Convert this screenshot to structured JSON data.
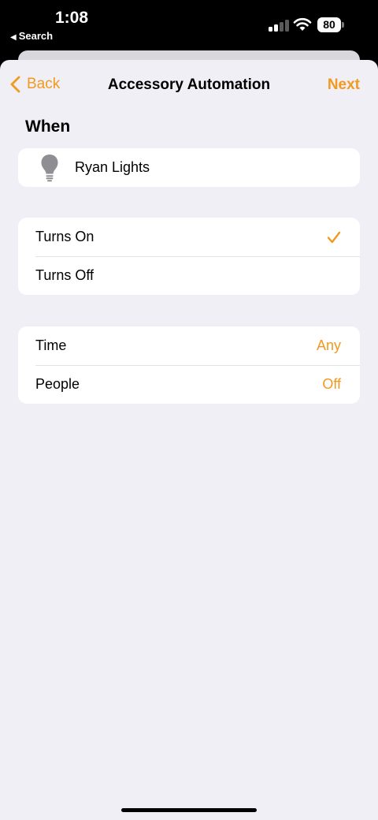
{
  "status": {
    "time": "1:08",
    "back_app": "Search",
    "battery": "80"
  },
  "nav": {
    "back_label": "Back",
    "title": "Accessory Automation",
    "next_label": "Next"
  },
  "when": {
    "title": "When",
    "accessory_name": "Ryan Lights",
    "accessory_icon": "lightbulb-icon"
  },
  "trigger_options": [
    {
      "label": "Turns On",
      "selected": true
    },
    {
      "label": "Turns Off",
      "selected": false
    }
  ],
  "conditions": [
    {
      "label": "Time",
      "value": "Any"
    },
    {
      "label": "People",
      "value": "Off"
    }
  ],
  "colors": {
    "accent": "#f09a20",
    "background": "#f0eff5",
    "card": "#ffffff"
  }
}
